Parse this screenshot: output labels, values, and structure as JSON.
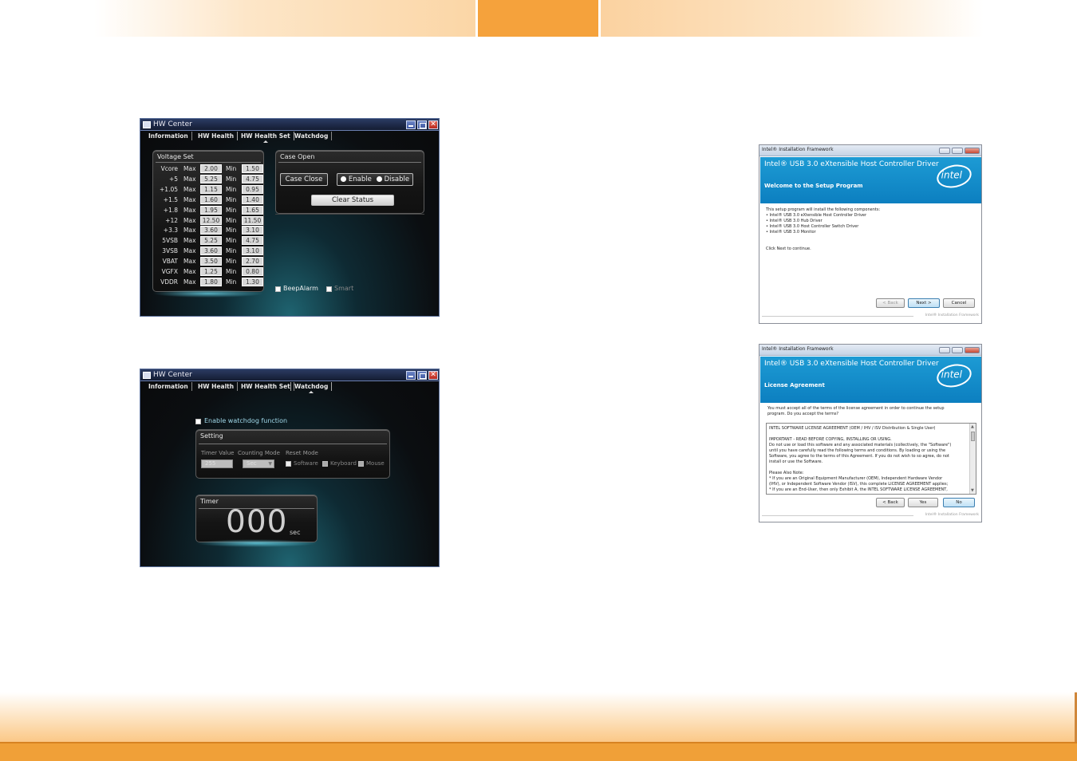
{
  "hw1": {
    "title": "HW Center",
    "tabs": [
      "Information",
      "HW Health",
      "HW Health Set",
      "Watchdog"
    ],
    "voltage_title": "Voltage Set",
    "max_label": "Max",
    "min_label": "Min",
    "rows": [
      {
        "name": "Vcore",
        "max": "2.00",
        "min": "1.50"
      },
      {
        "name": "+5",
        "max": "5.25",
        "min": "4.75"
      },
      {
        "name": "+1.05",
        "max": "1.15",
        "min": "0.95"
      },
      {
        "name": "+1.5",
        "max": "1.60",
        "min": "1.40"
      },
      {
        "name": "+1.8",
        "max": "1.95",
        "min": "1.65"
      },
      {
        "name": "+12",
        "max": "12.50",
        "min": "11.50"
      },
      {
        "name": "+3.3",
        "max": "3.60",
        "min": "3.10"
      },
      {
        "name": "5VSB",
        "max": "5.25",
        "min": "4.75"
      },
      {
        "name": "3VSB",
        "max": "3.60",
        "min": "3.10"
      },
      {
        "name": "VBAT",
        "max": "3.50",
        "min": "2.70"
      },
      {
        "name": "VGFX",
        "max": "1.25",
        "min": "0.80"
      },
      {
        "name": "VDDR",
        "max": "1.80",
        "min": "1.30"
      }
    ],
    "case_open_title": "Case Open",
    "case_close_label": "Case Close",
    "enable_label": "Enable",
    "disable_label": "Disable",
    "clear_status_label": "Clear Status",
    "beep_alarm_label": "BeepAlarm",
    "smart_label": "Smart"
  },
  "hw2": {
    "title": "HW Center",
    "tabs": [
      "Information",
      "HW Health",
      "HW Health Set",
      "Watchdog"
    ],
    "enable_watchdog_label": "Enable watchdog function",
    "setting_title": "Setting",
    "timer_value_label": "Timer Value",
    "counting_mode_label": "Counting Mode",
    "reset_mode_label": "Reset  Mode",
    "timer_value": "255",
    "counting_mode": "Sec",
    "software_label": "Software",
    "keyboard_label": "Keyboard",
    "mouse_label": "Mouse",
    "timer_title": "Timer",
    "timer_count": "000",
    "timer_unit": "sec"
  },
  "intel1": {
    "window_title": "Intel® Installation Framework",
    "heading": "Intel® USB 3.0 eXtensible Host Controller Driver",
    "subheading": "Welcome to the Setup Program",
    "intro": "This setup program will install the following components:",
    "components": [
      "• Intel® USB 3.0 eXtensible Host Controller Driver",
      "• Intel® USB 3.0 Hub Driver",
      "• Intel® USB 3.0 Host Controller Switch Driver",
      "• Intel® USB 3.0 Monitor"
    ],
    "continue_text": "Click Next to continue.",
    "back_label": "< Back",
    "next_label": "Next >",
    "cancel_label": "Cancel",
    "footer": "Intel® Installation Framework",
    "logo_text": "intel"
  },
  "intel2": {
    "window_title": "Intel® Installation Framework",
    "heading": "Intel® USB 3.0 eXtensible Host Controller Driver",
    "subheading": "License Agreement",
    "prompt_lines": [
      "You must accept all of the terms of the license agreement in order to continue the setup",
      "program. Do you accept the terms?"
    ],
    "license_lines": [
      "INTEL SOFTWARE LICENSE AGREEMENT (OEM / IHV / ISV Distribution & Single User)",
      "",
      "IMPORTANT - READ BEFORE COPYING, INSTALLING OR USING.",
      "Do not use or load this software and any associated materials (collectively, the \"Software\")",
      "until you have carefully read the following terms and conditions. By loading or using the",
      "Software, you agree to the terms of this Agreement. If you do not wish to so agree, do not",
      "install or use the Software.",
      "",
      "Please Also Note:",
      "* If you are an Original Equipment Manufacturer (OEM), Independent Hardware Vendor",
      "(IHV), or Independent Software Vendor (ISV), this complete LICENSE AGREEMENT applies;",
      "* If you are an End-User, then only Exhibit A, the INTEL SOFTWARE LICENSE AGREEMENT,"
    ],
    "back_label": "< Back",
    "yes_label": "Yes",
    "no_label": "No",
    "footer": "Intel® Installation Framework",
    "logo_text": "intel"
  }
}
